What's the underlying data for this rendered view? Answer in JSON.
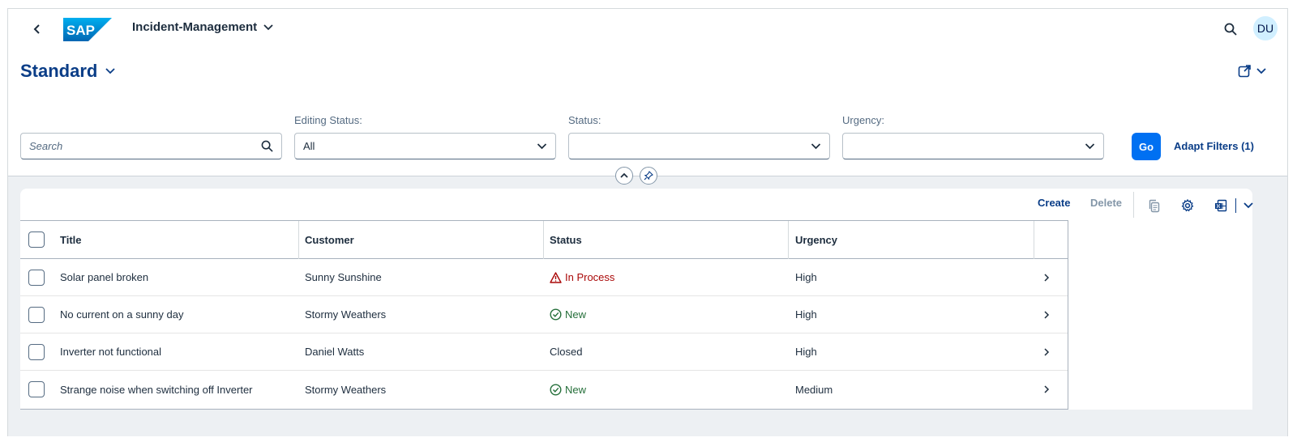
{
  "shell": {
    "logo_text": "SAP",
    "app_title": "Incident-Management",
    "avatar_initials": "DU"
  },
  "variant": {
    "title": "Standard"
  },
  "filters": {
    "search_placeholder": "Search",
    "editing_status": {
      "label": "Editing Status:",
      "value": "All"
    },
    "status": {
      "label": "Status:",
      "value": ""
    },
    "urgency": {
      "label": "Urgency:",
      "value": ""
    },
    "go_label": "Go",
    "adapt_label": "Adapt Filters (1)"
  },
  "toolbar": {
    "create_label": "Create",
    "delete_label": "Delete"
  },
  "table": {
    "columns": [
      "Title",
      "Customer",
      "Status",
      "Urgency"
    ],
    "rows": [
      {
        "title": "Solar panel broken",
        "customer": "Sunny Sunshine",
        "status": "In Process",
        "status_type": "warning",
        "urgency": "High"
      },
      {
        "title": "No current on a sunny day",
        "customer": "Stormy Weathers",
        "status": "New",
        "status_type": "success",
        "urgency": "High"
      },
      {
        "title": "Inverter not functional",
        "customer": "Daniel Watts",
        "status": "Closed",
        "status_type": "none",
        "urgency": "High"
      },
      {
        "title": "Strange noise when switching off Inverter",
        "customer": "Stormy Weathers",
        "status": "New",
        "status_type": "success",
        "urgency": "Medium"
      }
    ]
  },
  "colors": {
    "brand_blue": "#0a3d87",
    "primary_button": "#0070f2",
    "warning_text": "#aa0808",
    "success_text": "#256f3a",
    "content_background": "#edf0f3"
  }
}
